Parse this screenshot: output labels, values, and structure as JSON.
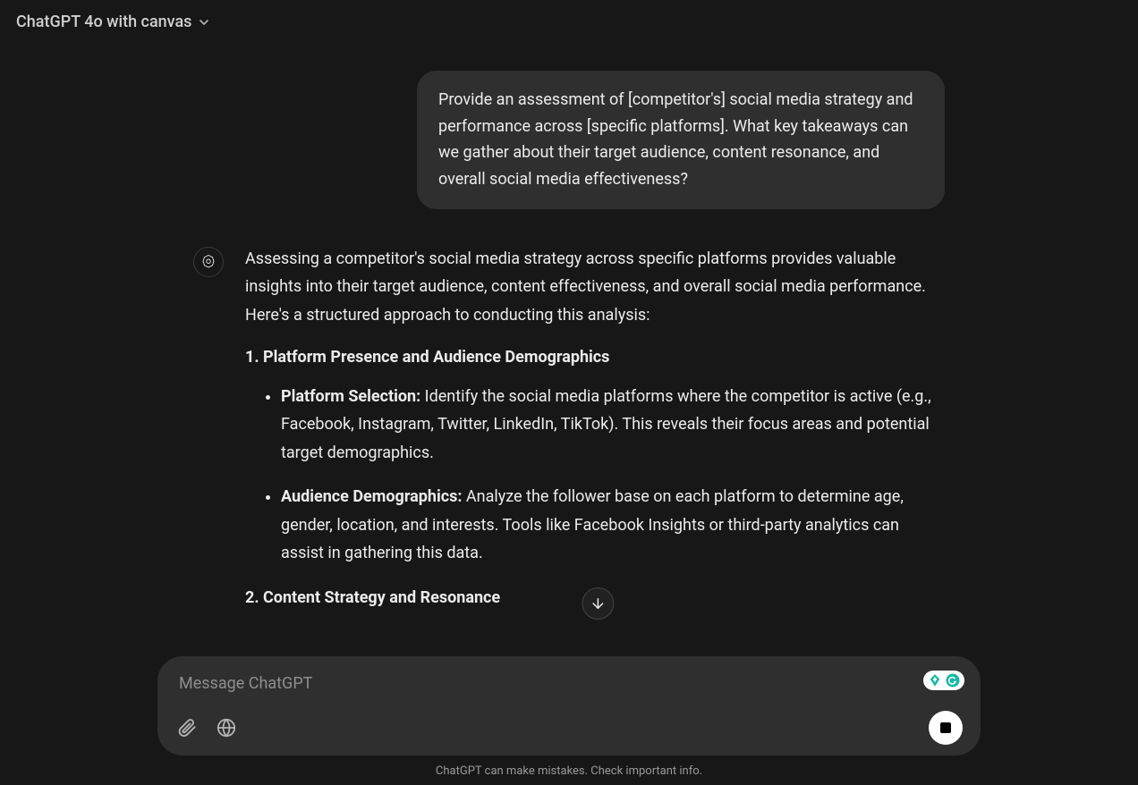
{
  "header": {
    "model_label": "ChatGPT 4o with canvas"
  },
  "conversation": {
    "user_message": "Provide an assessment of [competitor's] social media strategy and performance across [specific platforms]. What key takeaways can we gather about their target audience, content resonance, and overall social media effectiveness?",
    "assistant": {
      "intro": "Assessing a competitor's social media strategy across specific platforms provides valuable insights into their target audience, content effectiveness, and overall social media performance. Here's a structured approach to conducting this analysis:",
      "sections": [
        {
          "heading": "1. Platform Presence and Audience Demographics",
          "bullets": [
            {
              "label": "Platform Selection:",
              "text": " Identify the social media platforms where the competitor is active (e.g., Facebook, Instagram, Twitter, LinkedIn, TikTok). This reveals their focus areas and potential target demographics."
            },
            {
              "label": "Audience Demographics:",
              "text": " Analyze the follower base on each platform to determine age, gender, location, and interests. Tools like Facebook Insights or third-party analytics can assist in gathering this data."
            }
          ]
        },
        {
          "heading": "2. Content Strategy and Resonance",
          "bullets": []
        }
      ]
    }
  },
  "composer": {
    "placeholder": "Message ChatGPT"
  },
  "footer": {
    "disclaimer": "ChatGPT can make mistakes. Check important info."
  }
}
